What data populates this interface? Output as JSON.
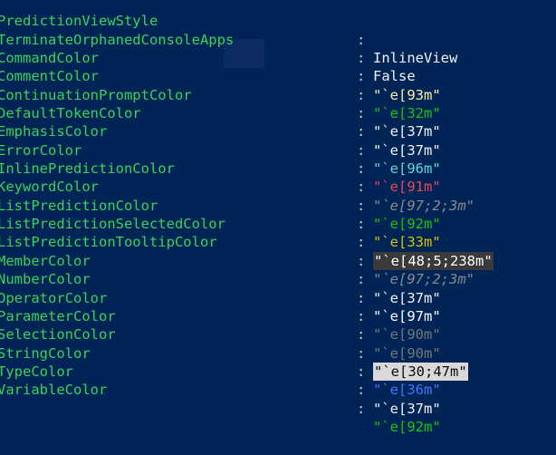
{
  "rows": [
    {
      "name": "PredictionViewStyle",
      "colon": ":",
      "value": "InlineView",
      "style": "plain"
    },
    {
      "name": "TerminateOrphanedConsoleApps",
      "colon": ":",
      "value": "False",
      "style": "plain"
    },
    {
      "name": "CommandColor",
      "colon": ":",
      "value": "\"`e[93m\"",
      "style": "yellow"
    },
    {
      "name": "CommentColor",
      "colon": ":",
      "value": "\"`e[32m\"",
      "style": "green"
    },
    {
      "name": "ContinuationPromptColor",
      "colon": ":",
      "value": "\"`e[37m\"",
      "style": "white"
    },
    {
      "name": "DefaultTokenColor",
      "colon": ":",
      "value": "\"`e[37m\"",
      "style": "white"
    },
    {
      "name": "EmphasisColor",
      "colon": ":",
      "value": "\"`e[96m\"",
      "style": "cyan"
    },
    {
      "name": "ErrorColor",
      "colon": ":",
      "value": "\"`e[91m\"",
      "style": "red"
    },
    {
      "name": "InlinePredictionColor",
      "colon": ":",
      "value": "\"`e[97;2;3m\"",
      "style": "gray-italic"
    },
    {
      "name": "KeywordColor",
      "colon": ":",
      "value": "\"`e[92m\"",
      "style": "bgreen"
    },
    {
      "name": "ListPredictionColor",
      "colon": ":",
      "value": "\"`e[33m\"",
      "style": "dyellow"
    },
    {
      "name": "ListPredictionSelectedColor",
      "colon": ":",
      "value": "\"`e[48;5;238m\"",
      "style": "selected"
    },
    {
      "name": "ListPredictionTooltipColor",
      "colon": ":",
      "value": "\"`e[97;2;3m\"",
      "style": "gray-italic"
    },
    {
      "name": "MemberColor",
      "colon": ":",
      "value": "\"`e[37m\"",
      "style": "white"
    },
    {
      "name": "NumberColor",
      "colon": ":",
      "value": "\"`e[97m\"",
      "style": "bwhite"
    },
    {
      "name": "OperatorColor",
      "colon": ":",
      "value": "\"`e[90m\"",
      "style": "dgray"
    },
    {
      "name": "ParameterColor",
      "colon": ":",
      "value": "\"`e[90m\"",
      "style": "dgray"
    },
    {
      "name": "SelectionColor",
      "colon": ":",
      "value": "\"`e[30;47m\"",
      "style": "inverse"
    },
    {
      "name": "StringColor",
      "colon": ":",
      "value": "\"`e[36m\"",
      "style": "blue"
    },
    {
      "name": "TypeColor",
      "colon": ":",
      "value": "\"`e[37m\"",
      "style": "white"
    },
    {
      "name": "VariableColor",
      "colon": ":",
      "value": "\"`e[92m\"",
      "style": "bgreen"
    }
  ],
  "colors": {
    "background": "#012456",
    "property_name": "#3ad35a"
  }
}
